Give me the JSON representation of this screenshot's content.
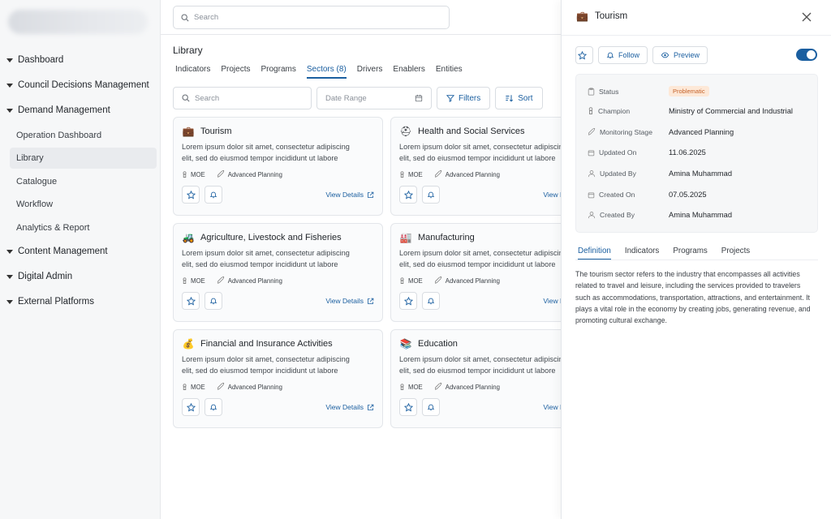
{
  "sidebar": {
    "groups": [
      {
        "label": "Dashboard"
      },
      {
        "label": "Council Decisions Management"
      },
      {
        "label": "Demand Management"
      },
      {
        "label": "Content Management"
      },
      {
        "label": "Digital Admin"
      },
      {
        "label": "External Platforms"
      }
    ],
    "subitems": [
      {
        "label": "Operation Dashboard"
      },
      {
        "label": "Library"
      },
      {
        "label": "Catalogue"
      },
      {
        "label": "Workflow"
      },
      {
        "label": "Analytics & Report"
      }
    ],
    "active_subitem": "Library"
  },
  "topbar": {
    "search_placeholder": "Search"
  },
  "library": {
    "title": "Library",
    "tabs": [
      {
        "label": "Indicators"
      },
      {
        "label": "Projects"
      },
      {
        "label": "Programs"
      },
      {
        "label": "Sectors (8)"
      },
      {
        "label": "Drivers"
      },
      {
        "label": "Enablers"
      },
      {
        "label": "Entities"
      }
    ],
    "active_tab": "Sectors (8)",
    "search_placeholder": "Search",
    "date_placeholder": "Date Range",
    "filters_label": "Filters",
    "sort_label": "Sort"
  },
  "cards": [
    {
      "title": "Tourism",
      "icon": "briefcase",
      "emoji": "💼",
      "desc1": "Lorem ipsum dolor sit amet, consectetur adipiscing",
      "desc2": "elit, sed do eiusmod tempor incididunt ut labore",
      "owner": "MOE",
      "stage": "Advanced Planning",
      "view": "View Details"
    },
    {
      "title": "Health and Social Services",
      "icon": "medical-kit",
      "emoji": "⛑",
      "desc1": "Lorem ipsum dolor sit amet, consectetur adipiscing",
      "desc2": "elit, sed do eiusmod tempor incididunt ut labore",
      "owner": "MOE",
      "stage": "Advanced Planning",
      "view": "View Details"
    },
    {
      "title": "Agriculture, Livestock and Fisheries",
      "icon": "tractor",
      "emoji": "🚜",
      "desc1": "Lorem ipsum dolor sit amet, consectetur adipiscing",
      "desc2": "elit, sed do eiusmod tempor incididunt ut labore",
      "owner": "MOE",
      "stage": "Advanced Planning",
      "view": "View Details"
    },
    {
      "title": "Manufacturing",
      "icon": "factory",
      "emoji": "🏭",
      "desc1": "Lorem ipsum dolor sit amet, consectetur adipiscing",
      "desc2": "elit, sed do eiusmod tempor incididunt ut labore",
      "owner": "MOE",
      "stage": "Advanced Planning",
      "view": "View Details"
    },
    {
      "title": "Financial and Insurance Activities",
      "icon": "money",
      "emoji": "💰",
      "desc1": "Lorem ipsum dolor sit amet, consectetur adipiscing",
      "desc2": "elit, sed do eiusmod tempor incididunt ut labore",
      "owner": "MOE",
      "stage": "Advanced Planning",
      "view": "View Details"
    },
    {
      "title": "Education",
      "icon": "education",
      "emoji": "📚",
      "desc1": "Lorem ipsum dolor sit amet, consectetur adipiscing",
      "desc2": "elit, sed do eiusmod tempor incididunt ut labore",
      "owner": "MOE",
      "stage": "Advanced Planning",
      "view": "View Details"
    }
  ],
  "panel": {
    "title": "Tourism",
    "emoji": "💼",
    "follow_label": "Follow",
    "preview_label": "Preview",
    "toggle_on": true,
    "fields": [
      {
        "label": "Status",
        "value": "Problematic",
        "icon": "clipboard"
      },
      {
        "label": "Champion",
        "value": "Ministry of Commercial and Industrial",
        "icon": "person"
      },
      {
        "label": "Monitoring Stage",
        "value": "Advanced Planning",
        "icon": "rocket"
      },
      {
        "label": "Updated On",
        "value": "11.06.2025",
        "icon": "calendar"
      },
      {
        "label": "Updated By",
        "value": "Amina Muhammad",
        "icon": "user"
      },
      {
        "label": "Created On",
        "value": "07.05.2025",
        "icon": "calendar"
      },
      {
        "label": "Created By",
        "value": "Amina Muhammad",
        "icon": "user"
      }
    ],
    "tabs": [
      {
        "label": "Definition"
      },
      {
        "label": "Indicators"
      },
      {
        "label": "Programs"
      },
      {
        "label": "Projects"
      }
    ],
    "active_tab": "Definition",
    "definition": "The tourism sector refers to the industry that encompasses all activities related to travel and leisure, including the services provided to travelers such as accommodations, transportation, attractions, and entertainment. It plays a vital role in the economy by creating jobs, generating revenue, and promoting cultural exchange."
  },
  "colors": {
    "accent": "#1b5fa0",
    "badge_bg": "#fde8d7",
    "badge_text": "#c4622a"
  }
}
